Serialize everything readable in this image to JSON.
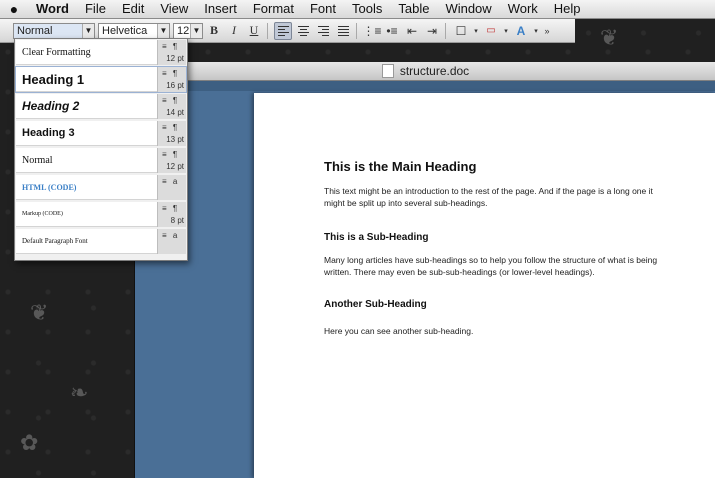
{
  "menubar": {
    "apple_icon": "apple-icon",
    "items": [
      "Word",
      "File",
      "Edit",
      "View",
      "Insert",
      "Format",
      "Font",
      "Tools",
      "Table",
      "Window",
      "Work",
      "Help"
    ]
  },
  "toolbar": {
    "style_value": "Normal",
    "font_value": "Helvetica",
    "size_value": "12",
    "bold_label": "B",
    "italic_label": "I",
    "underline_label": "U",
    "accent_color": "#3a7fc6"
  },
  "style_menu": {
    "items": [
      {
        "name": "Clear Formatting",
        "marks": "≡ ¶",
        "size": "12 pt"
      },
      {
        "name": "Heading 1",
        "marks": "≡ ¶",
        "size": "16 pt"
      },
      {
        "name": "Heading 2",
        "marks": "≡ ¶",
        "size": "14 pt"
      },
      {
        "name": "Heading 3",
        "marks": "≡ ¶",
        "size": "13 pt"
      },
      {
        "name": "Normal",
        "marks": "≡ ¶",
        "size": "12 pt"
      },
      {
        "name": "HTML (CODE)",
        "marks": "≡ a",
        "size": ""
      },
      {
        "name": "Markup (CODE)",
        "marks": "≡ ¶",
        "size": "8 pt"
      },
      {
        "name": "Default Paragraph Font",
        "marks": "≡ a",
        "size": ""
      }
    ]
  },
  "document": {
    "window_title": "structure.doc",
    "heading": "This is the Main Heading",
    "para1": "This text might be an introduction to the rest of the page. And if the page is a long one it might be split up into several sub-headings.",
    "subheading1": "This is a Sub-Heading",
    "para2": "Many long articles have sub-headings so to help you follow the structure of what is being written. There may even be sub-sub-headings (or lower-level headings).",
    "subheading2": "Another Sub-Heading",
    "para3": "Here you can see another sub-heading."
  }
}
